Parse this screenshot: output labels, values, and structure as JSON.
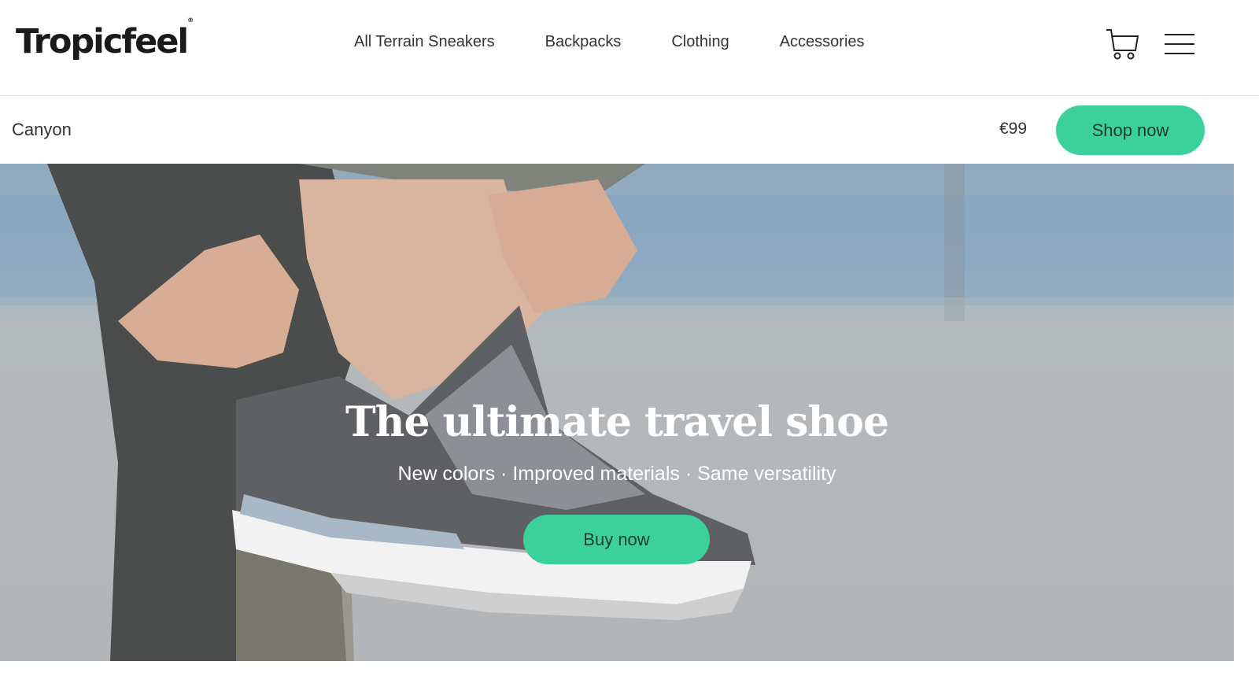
{
  "header": {
    "logo_text": "Tropicfeel",
    "logo_mark": "®",
    "nav": [
      {
        "label": "All Terrain Sneakers"
      },
      {
        "label": "Backpacks"
      },
      {
        "label": "Clothing"
      },
      {
        "label": "Accessories"
      }
    ],
    "cart_icon": "cart-icon",
    "menu_icon": "hamburger-menu-icon"
  },
  "product_bar": {
    "name": "Canyon",
    "price": "€99",
    "cta_label": "Shop now"
  },
  "hero": {
    "title": "The ultimate travel shoe",
    "subtitle": "New colors · Improved materials · Same versatility",
    "cta_label": "Buy now",
    "image_subject": "person pulling on a grey sneaker by the sea"
  },
  "colors": {
    "accent": "#3cd09a",
    "accent_text": "#173c2e"
  }
}
